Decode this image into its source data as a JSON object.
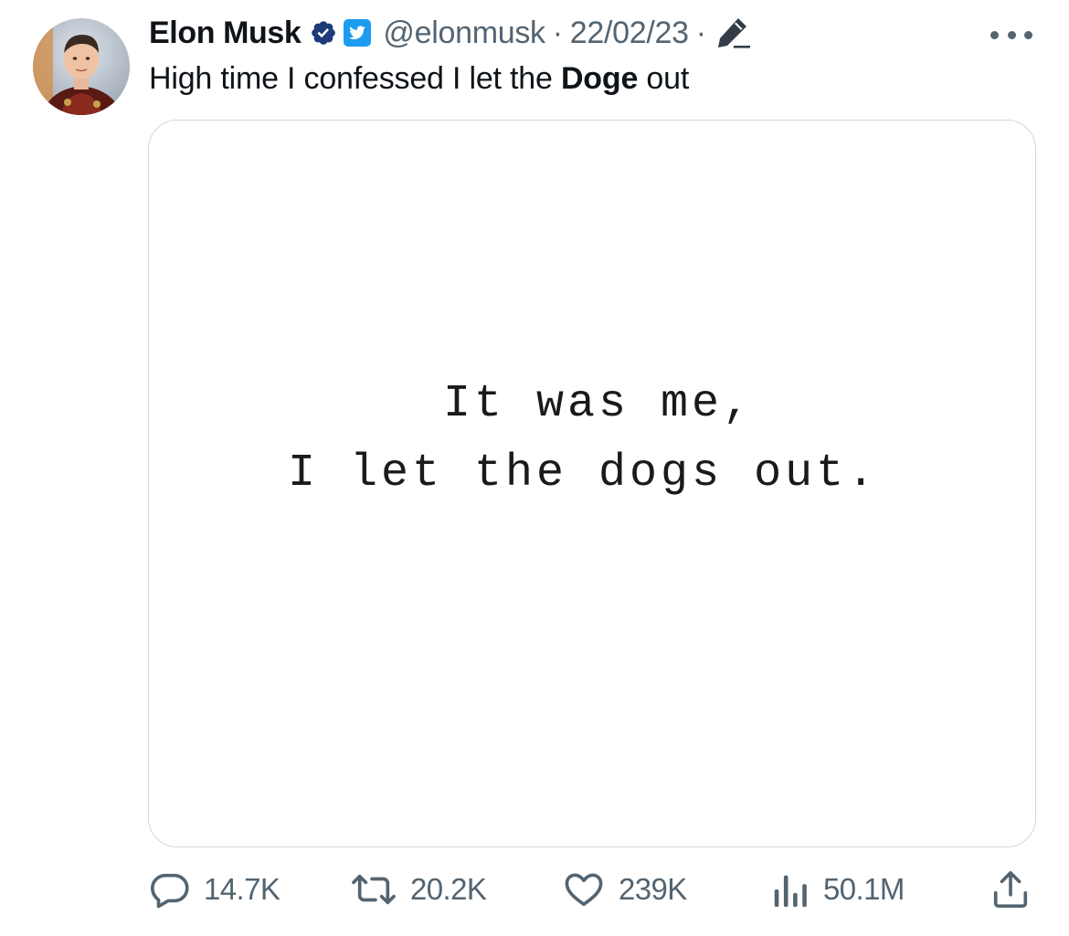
{
  "author": {
    "display_name": "Elon Musk",
    "handle": "@elonmusk",
    "date": "22/02/23",
    "separator": "·",
    "verified_badge_color": "#1d3b78",
    "twitter_badge_color": "#1d9bf0"
  },
  "tweet": {
    "text_before": "High time I confessed I let the ",
    "text_bold": "Doge",
    "text_after": " out"
  },
  "media": {
    "line1": "It was me,",
    "line2": "I let the dogs out."
  },
  "actions": {
    "replies": "14.7K",
    "retweets": "20.2K",
    "likes": "239K",
    "views": "50.1M"
  },
  "icons": {
    "avatar": "profile-photo",
    "verified": "verified-badge-icon",
    "twitter": "twitter-bird-icon",
    "edit": "edit-pencil-icon",
    "more": "more-dots-icon",
    "reply": "reply-icon",
    "retweet": "retweet-icon",
    "like": "heart-icon",
    "views": "views-chart-icon",
    "share": "share-icon"
  }
}
